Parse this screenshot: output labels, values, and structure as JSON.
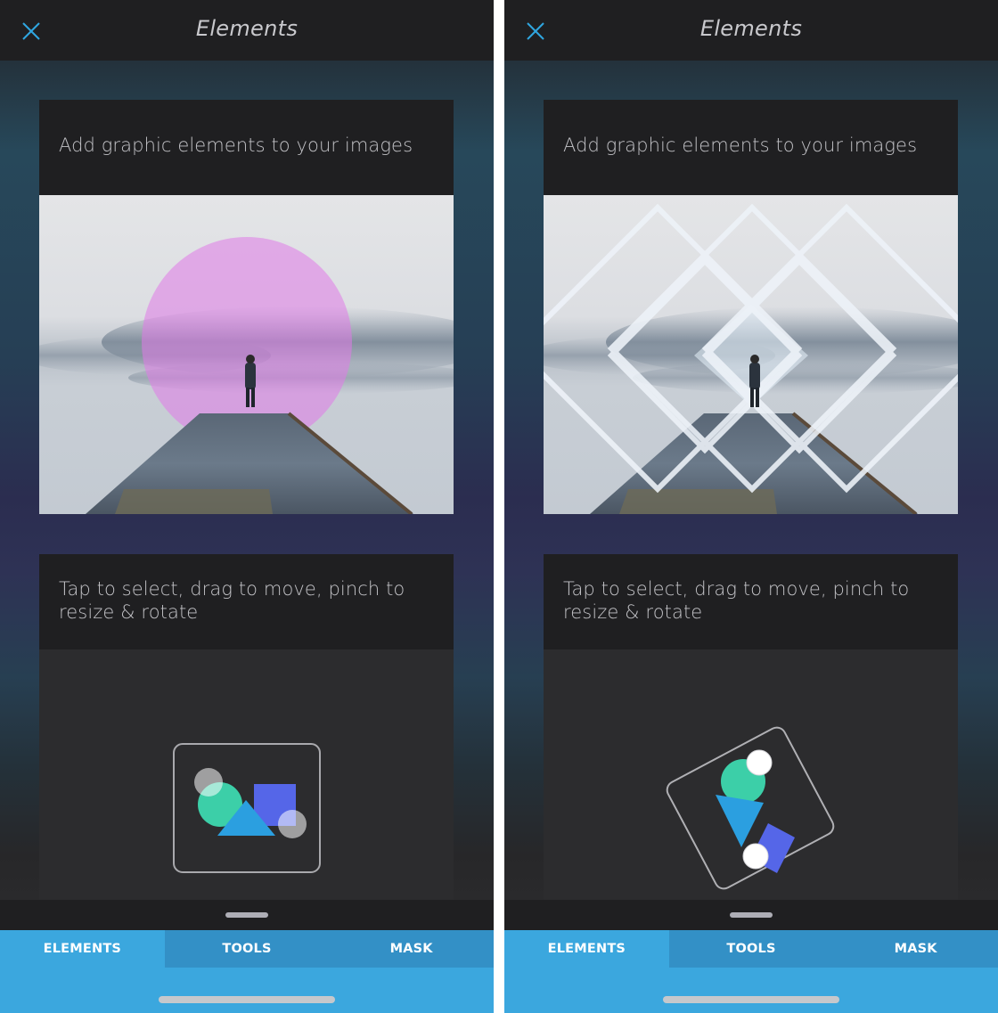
{
  "screens": [
    {
      "id": "left",
      "header": {
        "title": "Elements",
        "close_icon": "close-x-icon"
      },
      "cards": [
        {
          "caption": "Add graphic elements to your images",
          "overlay": "magenta-circle"
        },
        {
          "caption": "Tap to select, drag to move, pinch to resize & rotate",
          "demo_state": "unrotated"
        }
      ],
      "tabs": [
        {
          "label": "ELEMENTS",
          "active": true
        },
        {
          "label": "TOOLS",
          "active": false
        },
        {
          "label": "MASK",
          "active": false
        }
      ]
    },
    {
      "id": "right",
      "header": {
        "title": "Elements",
        "close_icon": "close-x-icon"
      },
      "cards": [
        {
          "caption": "Add graphic elements to your images",
          "overlay": "white-diamond-lattice"
        },
        {
          "caption": "Tap to select, drag to move, pinch to resize & rotate",
          "demo_state": "rotated"
        }
      ],
      "tabs": [
        {
          "label": "ELEMENTS",
          "active": true
        },
        {
          "label": "TOOLS",
          "active": false
        },
        {
          "label": "MASK",
          "active": false
        }
      ]
    }
  ],
  "colors": {
    "accent": "#3ba7de",
    "tab_inactive": "#3390c6",
    "close_icon": "#2fa6e0",
    "header_bg": "#1f1f21",
    "caption_text": "#c2c2c6",
    "shape_circle": "#3ccfa8",
    "shape_triangle": "#2b9fe0",
    "shape_square": "#5566e8",
    "overlay_circle": "#e07ae8"
  }
}
